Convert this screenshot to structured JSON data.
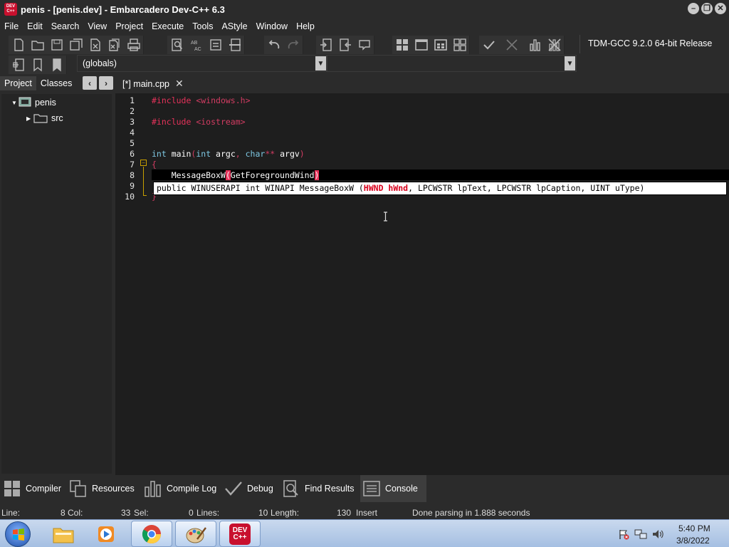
{
  "window": {
    "logo_text": "DEV C++",
    "title": "penis - [penis.dev] - Embarcadero Dev-C++ 6.3",
    "controls": [
      "minimize",
      "restore",
      "close"
    ]
  },
  "menu": [
    "File",
    "Edit",
    "Search",
    "View",
    "Project",
    "Execute",
    "Tools",
    "AStyle",
    "Window",
    "Help"
  ],
  "toolbar": {
    "compiler": "TDM-GCC 9.2.0 64-bit Release",
    "scope_combo": "(globals)",
    "members_combo": ""
  },
  "left_panel": {
    "tabs": [
      "Project",
      "Classes"
    ],
    "active_tab": "Project",
    "tree": [
      {
        "label": "penis",
        "type": "project",
        "expanded": true
      },
      {
        "label": "src",
        "type": "folder",
        "expanded": false
      }
    ]
  },
  "editor": {
    "tab_label": "[*] main.cpp",
    "lines": [
      {
        "no": "1",
        "text": "#include <windows.h>"
      },
      {
        "no": "2",
        "text": ""
      },
      {
        "no": "3",
        "text": "#include <iostream>"
      },
      {
        "no": "4",
        "text": ""
      },
      {
        "no": "5",
        "text": ""
      },
      {
        "no": "6",
        "text": "int main(int argc, char** argv)"
      },
      {
        "no": "7",
        "text": "{"
      },
      {
        "no": "8",
        "text": "    MessageBoxW(GetForegroundWind)"
      },
      {
        "no": "9",
        "text": ""
      },
      {
        "no": "10",
        "text": "}"
      }
    ],
    "tokens": {
      "l1_directive": "#include",
      "l1_header": "<windows.h>",
      "l3_directive": "#include",
      "l3_header": "<iostream>",
      "l6_int1": "int",
      "l6_main": " main",
      "l6_paren": "(",
      "l6_int2": "int",
      "l6_argc": " argc",
      "l6_comma": ",",
      "l6_char": " char",
      "l6_stars": "**",
      "l6_argv": " argv",
      "l6_close": ")",
      "l7": "{",
      "l8_indent": "    MessageBoxW",
      "l8_open": "(",
      "l8_arg": "GetForegroundWind",
      "l8_close": ")",
      "l10": "}"
    },
    "hint": {
      "prefix": "public WINUSERAPI int WINAPI MessageBoxW (",
      "current_param": "HWND hWnd",
      "suffix": ", LPCWSTR lpText, LPCWSTR lpCaption, UINT uType)"
    }
  },
  "bottom_tabs": [
    "Compiler",
    "Resources",
    "Compile Log",
    "Debug",
    "Find Results",
    "Console"
  ],
  "active_bottom_tab": "Console",
  "status": {
    "line_label": "Line:",
    "line_value": "8",
    "col_label": "Col:",
    "col_value": "33",
    "sel_label": "Sel:",
    "sel_value": "0",
    "lines_label": "Lines:",
    "lines_value": "10",
    "length_label": "Length:",
    "length_value": "130",
    "mode": "Insert",
    "message": "Done parsing in 1.888 seconds"
  },
  "taskbar": {
    "apps": [
      "start",
      "explorer",
      "media-player",
      "chrome",
      "paint",
      "devcpp"
    ],
    "time": "5:40 PM",
    "date": "3/8/2022"
  },
  "colors": {
    "keyword": "#7ec8e3",
    "preprocessor": "#e5325a",
    "background": "#1e1e1e",
    "chrome": "#2b2b2b"
  }
}
